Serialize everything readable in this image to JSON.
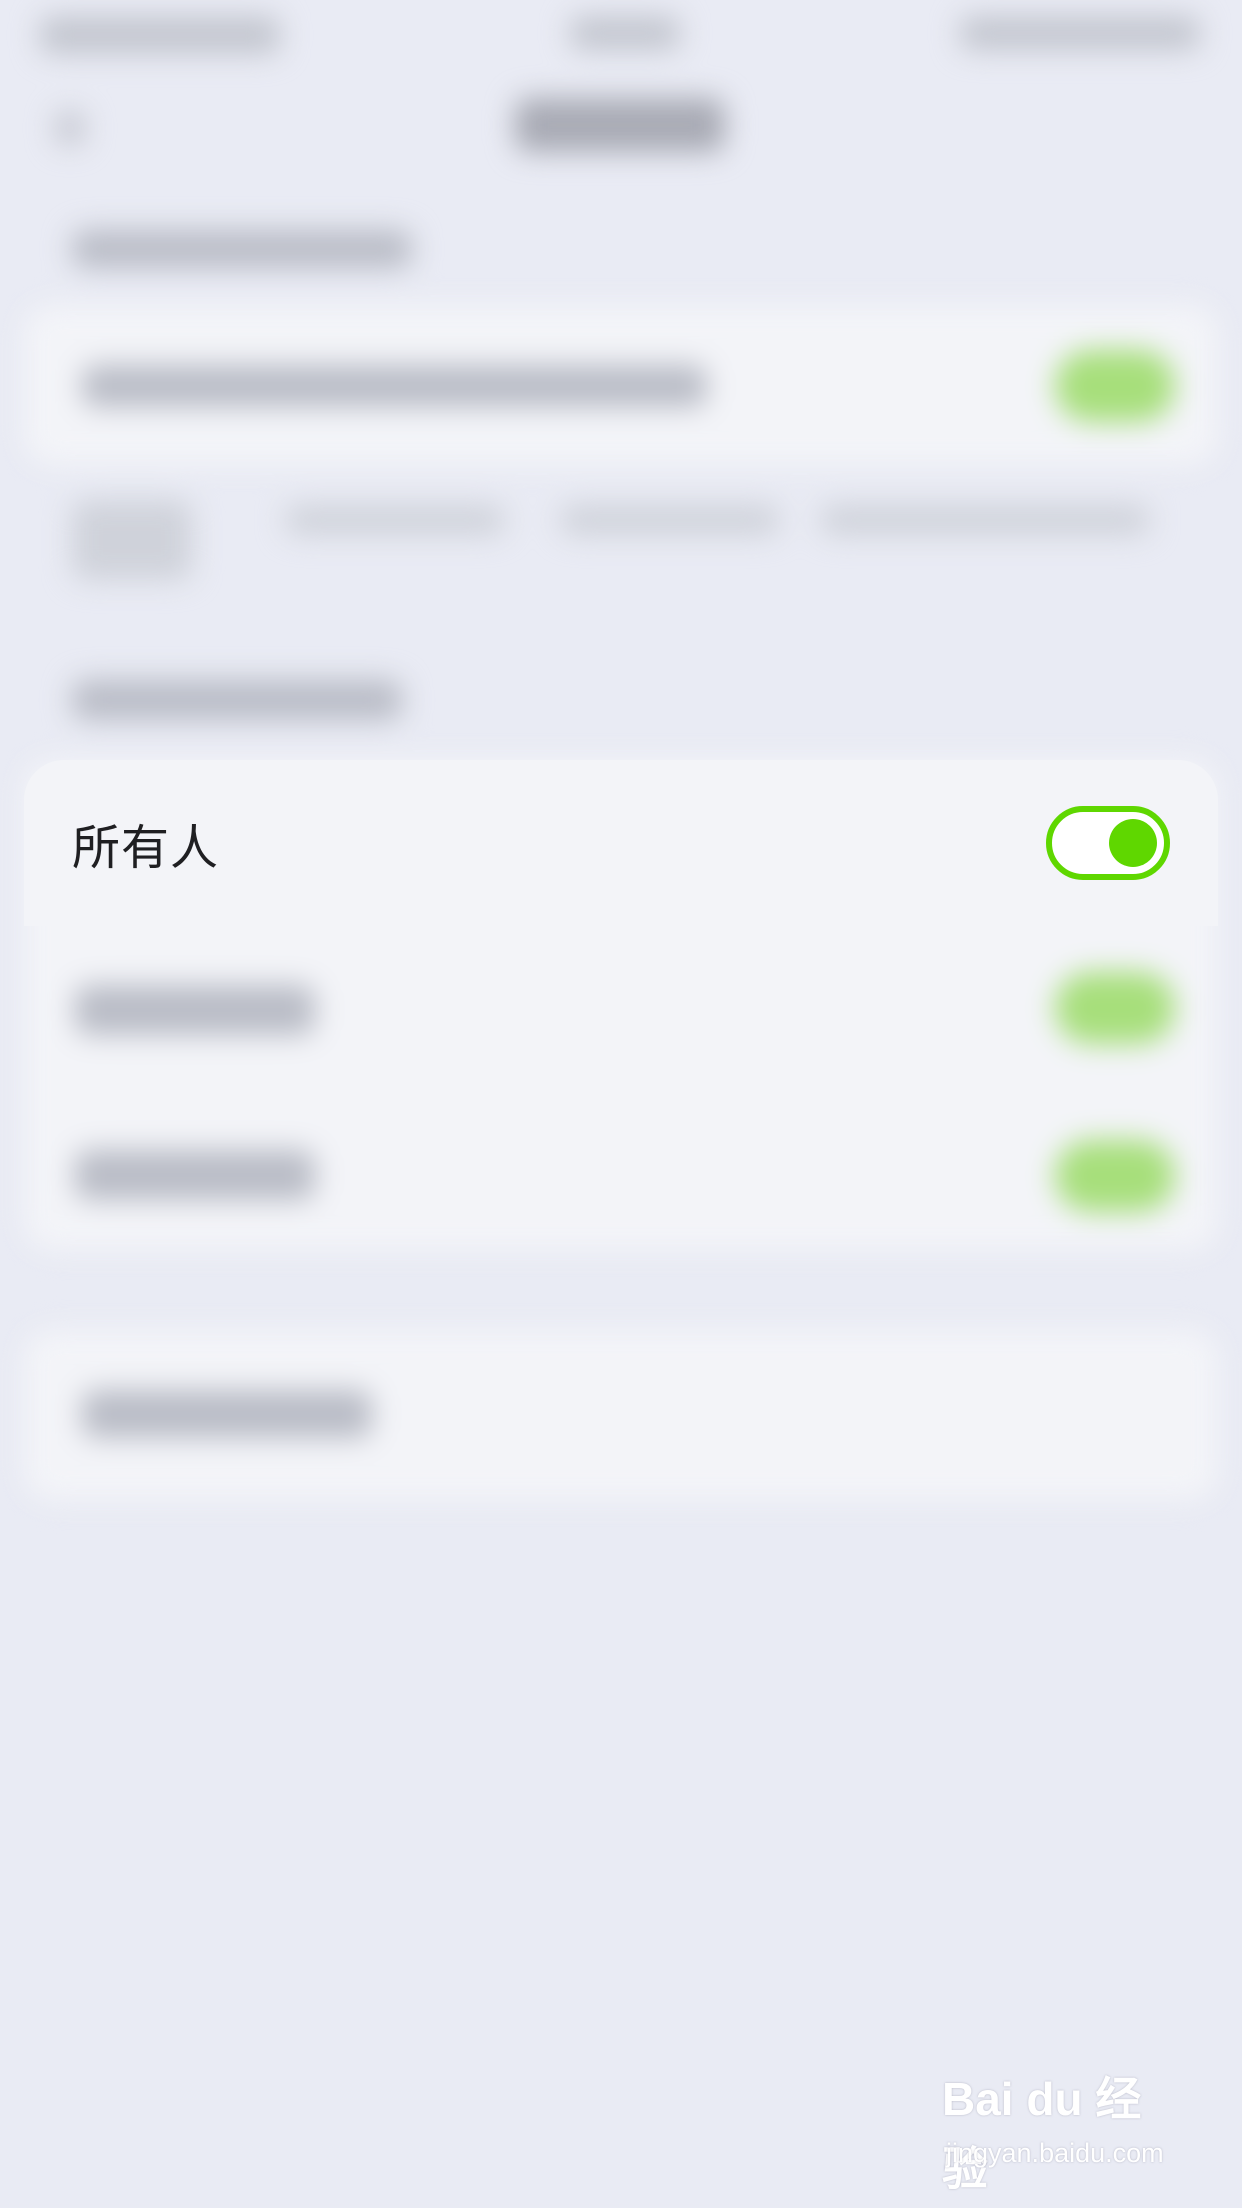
{
  "background_color": "#e9ebf4",
  "accent_color": "#5fd700",
  "focused_option": {
    "label": "所有人",
    "toggle_on": true
  },
  "watermark": {
    "logo_text": "Bai du 经验",
    "url": "jingyan.baidu.com"
  }
}
